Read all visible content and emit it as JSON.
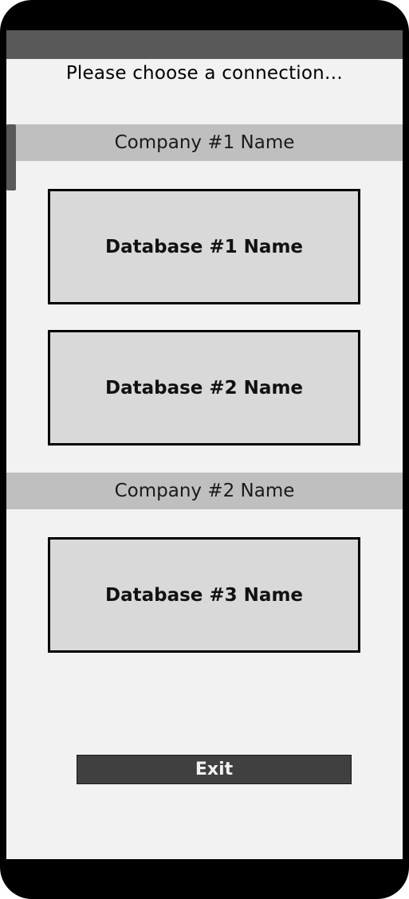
{
  "screen": {
    "prompt": "Please choose a connection…"
  },
  "companies": [
    {
      "name": "Company #1 Name",
      "databases": [
        {
          "name": "Database #1 Name"
        },
        {
          "name": "Database #2 Name"
        }
      ]
    },
    {
      "name": "Company #2 Name",
      "databases": [
        {
          "name": "Database #3 Name"
        }
      ]
    }
  ],
  "actions": {
    "exit_label": "Exit"
  },
  "colors": {
    "frame": "#000000",
    "status_bar": "#595959",
    "background": "#f2f2f2",
    "company_header": "#bfbfbf",
    "database_button": "#d9d9d9",
    "exit_button": "#404040"
  }
}
